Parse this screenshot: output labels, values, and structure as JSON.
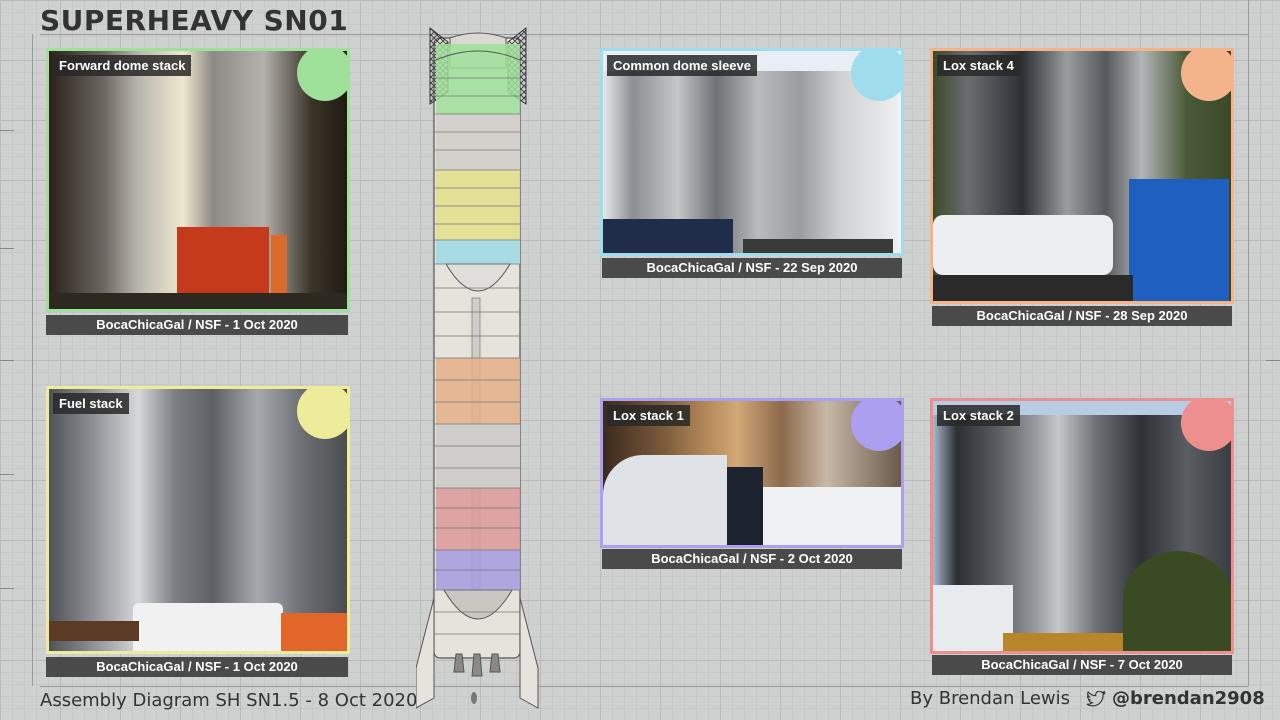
{
  "title": "SUPERHEAVY SN01",
  "footer": {
    "diagram": "Assembly Diagram SH SN1.5 - 8 Oct 2020",
    "author": "By Brendan Lewis",
    "handle": "@brendan2908"
  },
  "photos": [
    {
      "label": "Forward dome stack",
      "caption": "BocaChicaGal / NSF - 1 Oct 2020",
      "color": "#9fe09a"
    },
    {
      "label": "Fuel stack",
      "caption": "BocaChicaGal / NSF - 1 Oct 2020",
      "color": "#ecec9a"
    },
    {
      "label": "Common dome sleeve",
      "caption": "BocaChicaGal / NSF - 22 Sep 2020",
      "color": "#9fdcec"
    },
    {
      "label": "Lox stack 1",
      "caption": "BocaChicaGal / NSF - 2 Oct 2020",
      "color": "#ad9fef"
    },
    {
      "label": "Lox stack 4",
      "caption": "BocaChicaGal / NSF - 28 Sep 2020",
      "color": "#f3b48c"
    },
    {
      "label": "Lox stack 2",
      "caption": "BocaChicaGal / NSF - 7 Oct 2020",
      "color": "#ee8f8f"
    }
  ]
}
